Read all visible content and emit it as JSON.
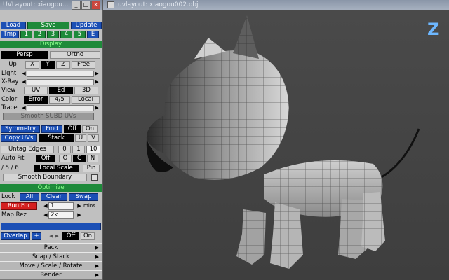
{
  "left_window_title": "UVLayout: xiaogou...",
  "viewport_title": "uvlayout: xiaogou002.obj",
  "watermark": "Z",
  "top": {
    "load": "Load",
    "save": "Save",
    "update": "Update",
    "tmp": "Tmp",
    "tmp_slots": [
      "1",
      "2",
      "3",
      "4",
      "5",
      "E"
    ]
  },
  "display": {
    "header": "Display",
    "persp": "Persp",
    "ortho": "Ortho",
    "up_label": "Up",
    "up_opts": [
      "X",
      "Y",
      "Z"
    ],
    "free": "Free",
    "light": "Light",
    "xray": "X-Ray",
    "view_label": "View",
    "view_opts": [
      "UV",
      "Ed",
      "3D"
    ],
    "color_label": "Color",
    "color_opts": [
      "Error",
      "4/5",
      "Local"
    ],
    "trace": "Trace",
    "smooth_subd": "Smooth SUBD UVs"
  },
  "ops": {
    "symmetry": "Symmetry",
    "find": "Find",
    "off": "Off",
    "on": "On",
    "copy_uvs": "Copy UVs",
    "stack": "Stack",
    "u": "U",
    "v": "V",
    "untag_edges": "Untag Edges",
    "untag_opts": [
      "0",
      "1",
      "10"
    ],
    "auto_fit": "Auto Fit",
    "af_off": "Off",
    "af_o": "O",
    "af_c": "C",
    "af_n": "N",
    "split": "/ 5 / 6",
    "local_scale": "Local Scale",
    "pin": "Pin",
    "smooth_boundary": "Smooth Boundary"
  },
  "optimize": {
    "header": "Optimize",
    "lock": "Lock",
    "all": "All",
    "clear": "Clear",
    "swap": "Swap",
    "run_for": "Run For",
    "run_value": "1",
    "mins": "mins",
    "map_rez": "Map Rez",
    "map_value": "2k"
  },
  "overlap": {
    "label": "Overlap",
    "plus": "+",
    "off": "Off",
    "on": "On"
  },
  "sections": [
    "Pack",
    "Snap / Stack",
    "Move / Scale / Rotate",
    "Render"
  ],
  "colors": {
    "blue": "#1b4fb5",
    "green": "#1e8a3a",
    "red": "#d41f1f",
    "panel": "#c0c0c0",
    "viewport": "#454545"
  }
}
